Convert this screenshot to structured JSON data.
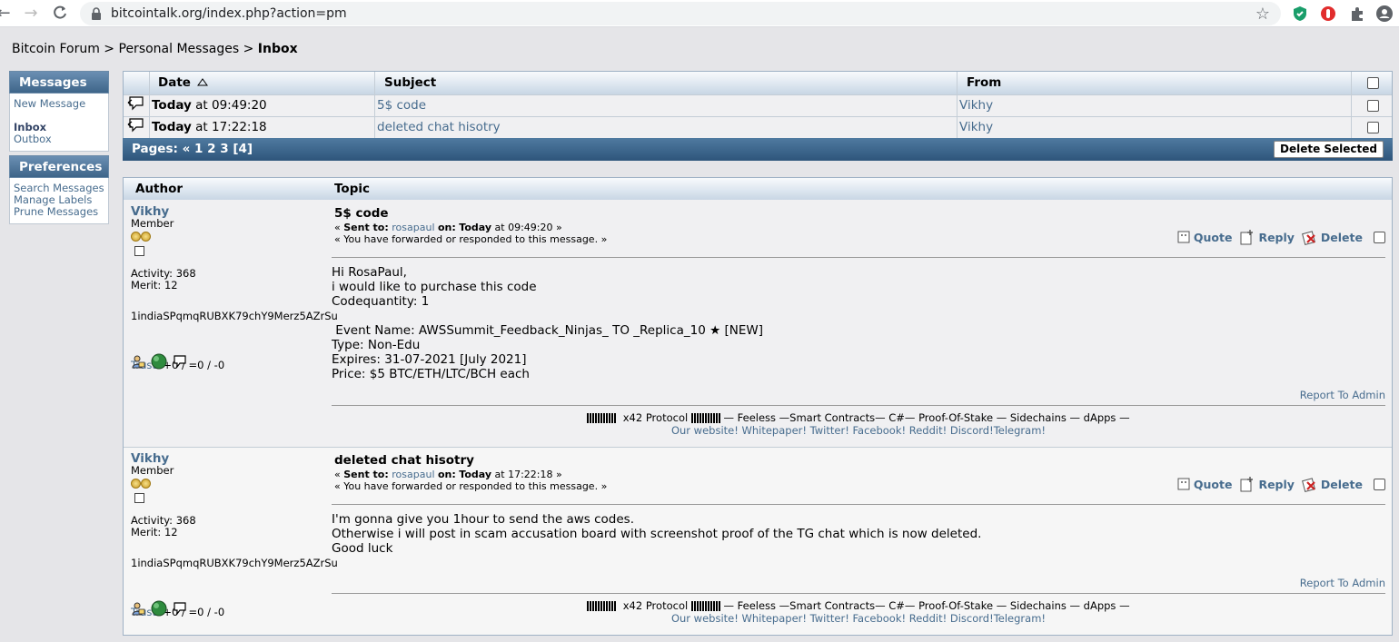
{
  "browser": {
    "url": "bitcointalk.org/index.php?action=pm"
  },
  "breadcrumb": {
    "part1": "Bitcoin Forum",
    "sep": " > ",
    "part2": "Personal Messages",
    "part3": "Inbox"
  },
  "sidebar": {
    "messages_header": "Messages",
    "new_message": "New Message",
    "inbox": "Inbox",
    "outbox": "Outbox",
    "preferences_header": "Preferences",
    "search_messages": "Search Messages",
    "manage_labels": "Manage Labels",
    "prune_messages": "Prune Messages"
  },
  "pm_list": {
    "col_date": "Date",
    "col_subject": "Subject",
    "col_from": "From",
    "rows": [
      {
        "date_bold": "Today",
        "date_rest": " at 09:49:20",
        "subject": "5$ code",
        "from": "Vikhy"
      },
      {
        "date_bold": "Today",
        "date_rest": " at 17:22:18",
        "subject": "deleted chat hisotry",
        "from": "Vikhy"
      }
    ],
    "pages_label": "Pages: «",
    "page_links": [
      "1",
      "2",
      "3"
    ],
    "current_page": "[4]",
    "delete_selected": "Delete Selected"
  },
  "messages_header": {
    "author": "Author",
    "topic": "Topic"
  },
  "posts": [
    {
      "author": "Vikhy",
      "rank": "Member",
      "activity": "Activity: 368",
      "merit": "Merit: 12",
      "address": "1indiaSPqmqRUBXK79chY9Merz5AZrSu",
      "trust_label": "Trust",
      "trust_value": ": +0 / =0 / -0",
      "subject": "5$ code",
      "sent_prefix": "« ",
      "sent_to_label": "Sent to:",
      "sent_to_user": "rosapaul",
      "sent_on_label": "on:",
      "sent_on_bold": "Today",
      "sent_on_rest": " at 09:49:20 »",
      "forwarded": "« You have forwarded or responded to this message. »",
      "quote": "Quote",
      "reply": "Reply",
      "delete": "Delete",
      "body": [
        "Hi RosaPaul,",
        "i would like to purchase this code",
        "Codequantity: 1",
        "",
        " Event Name: AWSSummit_Feedback_Ninjas_ TO _Replica_10 ★ [NEW]",
        "Type: Non-Edu",
        "Expires: 31-07-2021 [July 2021]",
        "Price: $5 BTC/ETH/LTC/BCH each"
      ],
      "report": "Report To Admin",
      "sig_line1_a": "x42 Protocol",
      "sig_line1_b": "— Feeless —Smart Contracts— C#— Proof-Of-Stake  — Sidechains — dApps —",
      "sig_line2": "Our website! Whitepaper! Twitter! Facebook! Reddit! Discord!Telegram!"
    },
    {
      "author": "Vikhy",
      "rank": "Member",
      "activity": "Activity: 368",
      "merit": "Merit: 12",
      "address": "1indiaSPqmqRUBXK79chY9Merz5AZrSu",
      "trust_label": "Trust",
      "trust_value": ": +0 / =0 / -0",
      "subject": "deleted chat hisotry",
      "sent_prefix": "« ",
      "sent_to_label": "Sent to:",
      "sent_to_user": "rosapaul",
      "sent_on_label": "on:",
      "sent_on_bold": "Today",
      "sent_on_rest": " at 17:22:18 »",
      "forwarded": "« You have forwarded or responded to this message. »",
      "quote": "Quote",
      "reply": "Reply",
      "delete": "Delete",
      "body": [
        "I'm gonna give you 1hour to send the aws codes.",
        "Otherwise i will post in scam accusation board with screenshot proof of the TG chat which is now deleted.",
        "Good luck"
      ],
      "report": "Report To Admin",
      "sig_line1_a": "x42 Protocol",
      "sig_line1_b": "— Feeless —Smart Contracts— C#— Proof-Of-Stake  — Sidechains — dApps —",
      "sig_line2": "Our website! Whitepaper! Twitter! Facebook! Reddit! Discord!Telegram!"
    }
  ]
}
